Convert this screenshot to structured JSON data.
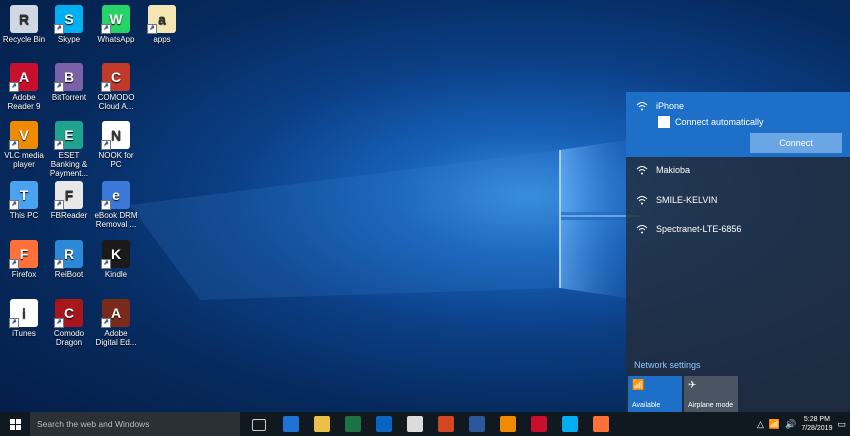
{
  "desktop": {
    "icons": [
      {
        "label": "Recycle Bin",
        "icon": "recycle-bin-icon",
        "color": "#cfd8e3"
      },
      {
        "label": "Skype",
        "icon": "skype-icon",
        "color": "#00aff0"
      },
      {
        "label": "WhatsApp",
        "icon": "whatsapp-icon",
        "color": "#25d366"
      },
      {
        "label": "apps",
        "icon": "folder-file-icon",
        "color": "#f3e6b3"
      },
      {
        "label": "Adobe Reader 9",
        "icon": "adobe-reader-icon",
        "color": "#c8102e"
      },
      {
        "label": "BitTorrent",
        "icon": "bittorrent-icon",
        "color": "#7b61a8"
      },
      {
        "label": "COMODO Cloud A...",
        "icon": "comodo-cloud-icon",
        "color": "#c0392b"
      },
      {
        "label": "VLC media player",
        "icon": "vlc-icon",
        "color": "#f08a00"
      },
      {
        "label": "ESET Banking & Payment...",
        "icon": "eset-banking-icon",
        "color": "#1ea38e"
      },
      {
        "label": "NOOK for PC",
        "icon": "nook-icon",
        "color": "#ffffff"
      },
      {
        "label": "This PC",
        "icon": "this-pc-icon",
        "color": "#4aa3ee"
      },
      {
        "label": "FBReader",
        "icon": "fbreader-icon",
        "color": "#e8e8e8"
      },
      {
        "label": "eBook DRM Removal ...",
        "icon": "ebook-drm-icon",
        "color": "#3c78d8"
      },
      {
        "label": "Firefox",
        "icon": "firefox-icon",
        "color": "#ff7139"
      },
      {
        "label": "ReiBoot",
        "icon": "reiboot-icon",
        "color": "#2a8ad8"
      },
      {
        "label": "Kindle",
        "icon": "kindle-icon",
        "color": "#1a1a1a"
      },
      {
        "label": "iTunes",
        "icon": "itunes-icon",
        "color": "#ffffff"
      },
      {
        "label": "Comodo Dragon",
        "icon": "comodo-dragon-icon",
        "color": "#a8161b"
      },
      {
        "label": "Adobe Digital Ed...",
        "icon": "adobe-digital-editions-icon",
        "color": "#7a2a1a"
      }
    ]
  },
  "network_panel": {
    "selected": {
      "name": "iPhone",
      "checkbox_label": "Connect automatically",
      "button": "Connect"
    },
    "networks": [
      "Makioba",
      "SMILE-KELVIN",
      "Spectranet-LTE-6856"
    ],
    "settings_link": "Network settings",
    "tiles": [
      {
        "label": "Available",
        "icon": "wifi-icon",
        "active": true
      },
      {
        "label": "Airplane mode",
        "icon": "airplane-icon",
        "active": false
      }
    ],
    "accent": "#1e6fc7"
  },
  "taskbar": {
    "search_placeholder": "Search the web and Windows",
    "clock_time": "5:28 PM",
    "clock_date": "7/28/2019",
    "pinned": [
      "task-view-icon",
      "edge-icon",
      "file-explorer-icon",
      "excel-icon",
      "outlook-icon",
      "store-icon",
      "powerpoint-icon",
      "word-icon",
      "vlc-icon",
      "acrobat-icon",
      "skype-icon",
      "firefox-icon"
    ]
  }
}
